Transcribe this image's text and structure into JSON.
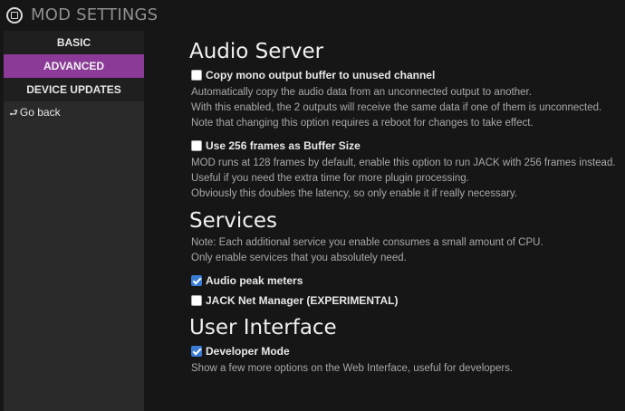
{
  "app": {
    "title": "MOD SETTINGS"
  },
  "sidebar": {
    "items": [
      {
        "label": "BASIC"
      },
      {
        "label": "ADVANCED"
      },
      {
        "label": "DEVICE UPDATES"
      }
    ],
    "back_label": "Go back"
  },
  "audio_server": {
    "title": "Audio Server",
    "copy_mono": {
      "label": "Copy mono output buffer to unused channel",
      "checked": false,
      "desc": [
        "Automatically copy the audio data from an unconnected output to another.",
        "With this enabled, the 2 outputs will receive the same data if one of them is unconnected.",
        "Note that changing this option requires a reboot for changes to take effect."
      ]
    },
    "frames_256": {
      "label": "Use 256 frames as Buffer Size",
      "checked": false,
      "desc": [
        "MOD runs at 128 frames by default, enable this option to run JACK with 256 frames instead.",
        "Useful if you need the extra time for more plugin processing.",
        "Obviously this doubles the latency, so only enable it if really necessary."
      ]
    }
  },
  "services": {
    "title": "Services",
    "note": [
      "Note: Each additional service you enable consumes a small amount of CPU.",
      "Only enable services that you absolutely need."
    ],
    "peak_meters": {
      "label": "Audio peak meters",
      "checked": true
    },
    "jack_net": {
      "label": "JACK Net Manager (EXPERIMENTAL)",
      "checked": false
    }
  },
  "user_interface": {
    "title": "User Interface",
    "dev_mode": {
      "label": "Developer Mode",
      "checked": true,
      "desc": [
        "Show a few more options on the Web Interface, useful for developers."
      ]
    }
  },
  "colors": {
    "background": "#161616",
    "sidebar": "#2a2a2a",
    "accent_active": "#8b3a98",
    "checkbox_checked": "#3a7bd5"
  }
}
